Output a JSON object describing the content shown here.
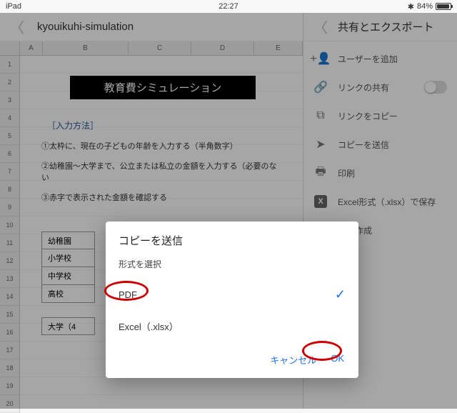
{
  "status": {
    "device": "iPad",
    "time": "22:27",
    "bluetooth": "✱",
    "battery_pct": "84%"
  },
  "toolbar": {
    "doc_title": "kyouikuhi-simulation"
  },
  "columns": [
    "A",
    "B",
    "C",
    "D",
    "E"
  ],
  "row_numbers": [
    1,
    2,
    3,
    4,
    5,
    6,
    7,
    8,
    9,
    10,
    11,
    12,
    13,
    14,
    15,
    16,
    17,
    18,
    19,
    20
  ],
  "sheet": {
    "banner": "教育費シミュレーション",
    "section_label": "［入力方法］",
    "line1": "①太枠に、現在の子どもの年齢を入力する（半角数字）",
    "line2": "②幼稚園～大学まで、公立または私立の金額を入力する（必要のない",
    "line3": "③赤字で表示された金額を確認する",
    "tbl": {
      "r1": "幼稚園",
      "r2": "小学校",
      "r3": "中学校",
      "r4": "高校",
      "r5": "大学（4"
    }
  },
  "panel": {
    "title": "共有とエクスポート",
    "items": {
      "add_user": "ユーザーを追加",
      "share_link": "リンクの共有",
      "copy_link": "リンクをコピー",
      "send_copy": "コピーを送信",
      "print": "印刷",
      "save_xlsx": "Excel形式（.xlsx）で保存",
      "make_copy_suffix": "ーを作成"
    }
  },
  "dialog": {
    "title": "コピーを送信",
    "subtitle": "形式を選択",
    "opt_pdf": "PDF",
    "opt_xlsx": "Excel（.xlsx）",
    "cancel": "キャンセル",
    "ok": "OK"
  }
}
